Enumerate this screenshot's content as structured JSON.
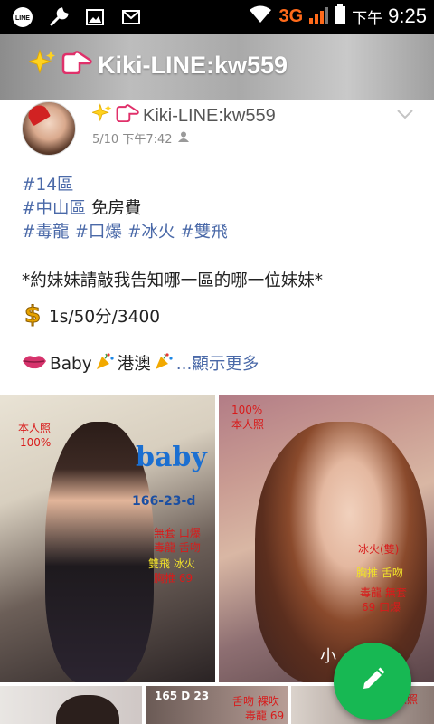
{
  "status_bar": {
    "icons": [
      "line-icon",
      "wrench-icon",
      "image-icon",
      "gmail-icon"
    ],
    "network": "3G",
    "ampm": "下午",
    "time": "9:25"
  },
  "header": {
    "title": "Kiki-LINE:kw559",
    "emoji": [
      "sparkles-icon",
      "pointing-finger-icon"
    ]
  },
  "post": {
    "author": "Kiki-LINE:kw559",
    "timestamp": "5/10 下午7:42",
    "content": {
      "tag_line1": "#14區",
      "tag_line2_tag": "#中山區",
      "tag_line2_text": " 免房費",
      "tag_line3": [
        "#毒龍",
        "#口爆",
        "#冰火",
        "#雙飛"
      ],
      "notice": "*約妹妹請敲我告知哪一區的哪一位妹妹*",
      "price": "1s/50分/3400",
      "baby_text": "Baby",
      "gangao_text": "港澳",
      "more": "...顯示更多"
    },
    "photos": {
      "p1": {
        "badge_line1": "本人照",
        "badge_line2": "100%",
        "name": "baby",
        "code": "166-23-d",
        "svc_line1": "無套 口爆",
        "svc_line2": "毒龍 舌吻",
        "svc_line3": "雙飛 冰火",
        "svc_line4": "胸推 69"
      },
      "p2": {
        "badge_line1": "100%",
        "badge_line2": "本人照",
        "svc_line1": "冰火(雙)",
        "svc_line2": "胸推 舌吻",
        "svc_line3": "毒龍 無套",
        "svc_line4": "69 口爆",
        "name_char": "小"
      },
      "p4": {
        "code": "165 D 23",
        "svc_line1": "舌吻 裸吹",
        "svc_line2": "毒龍 69"
      },
      "p5": {
        "badge": "本人照"
      }
    }
  },
  "fab": {
    "icon": "pencil-icon"
  },
  "colors": {
    "status_bar_bg": "#000000",
    "network_orange": "#ff6a1a",
    "tag_blue": "#4a69a8",
    "fab_green": "#17b853"
  }
}
